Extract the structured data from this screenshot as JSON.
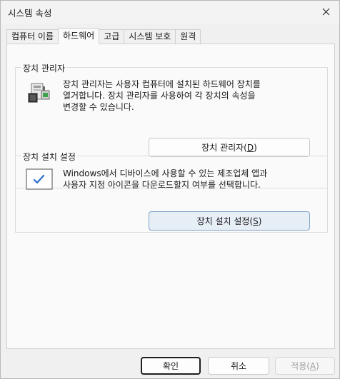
{
  "window": {
    "title": "시스템 속성"
  },
  "tabs": [
    {
      "label": "컴퓨터 이름"
    },
    {
      "label": "하드웨어"
    },
    {
      "label": "고급"
    },
    {
      "label": "시스템 보호"
    },
    {
      "label": "원격"
    }
  ],
  "device_manager": {
    "title": "장치 관리자",
    "description_line1": "장치 관리자는 사용자 컴퓨터에 설치된 하드웨어 장치를",
    "description_line2": "열거합니다. 장치 관리자를 사용하여 각 장치의 속성을",
    "description_line3": "변경할 수 있습니다.",
    "button_text": "장치 관리자(",
    "button_key": "D",
    "button_suffix": ")"
  },
  "device_install": {
    "title": "장치 설치 설정",
    "description_line1": "Windows에서 디바이스에 사용할 수 있는 제조업체 앱과",
    "description_line2": "사용자 지정 아이콘을 다운로드할지 여부를 선택합니다.",
    "button_text": "장치 설치 설정(",
    "button_key": "S",
    "button_suffix": ")"
  },
  "footer": {
    "ok_label": "확인",
    "cancel_label": "취소",
    "apply_text": "적용(",
    "apply_key": "A",
    "apply_suffix": ")"
  },
  "colors": {
    "accent": "#005fb8",
    "panel": "#fafafa",
    "window": "#f0f0f0"
  },
  "icons": [
    "close-icon",
    "device-manager-icon",
    "device-install-settings-icon"
  ]
}
